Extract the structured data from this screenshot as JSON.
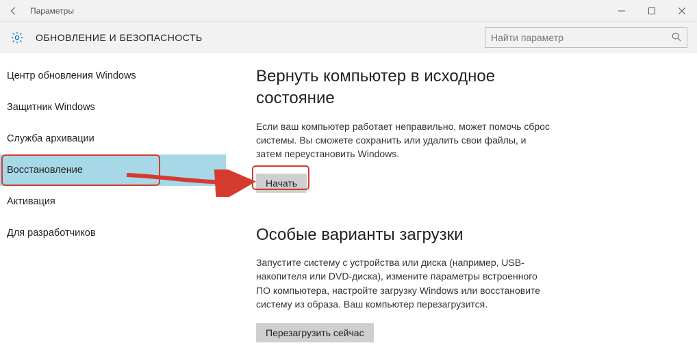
{
  "window": {
    "title": "Параметры"
  },
  "category": {
    "title": "ОБНОВЛЕНИЕ И БЕЗОПАСНОСТЬ"
  },
  "search": {
    "placeholder": "Найти параметр"
  },
  "sidebar": {
    "items": [
      {
        "label": "Центр обновления Windows"
      },
      {
        "label": "Защитник Windows"
      },
      {
        "label": "Служба архивации"
      },
      {
        "label": "Восстановление"
      },
      {
        "label": "Активация"
      },
      {
        "label": "Для разработчиков"
      }
    ]
  },
  "main": {
    "reset": {
      "heading": "Вернуть компьютер в исходное состояние",
      "desc": "Если ваш компьютер работает неправильно, может помочь сброс системы. Вы сможете сохранить или удалить свои файлы, и затем переустановить Windows.",
      "button": "Начать"
    },
    "adv": {
      "heading": "Особые варианты загрузки",
      "desc": "Запустите систему с устройства или диска (например, USB-накопителя или DVD-диска), измените параметры встроенного ПО компьютера, настройте загрузку Windows или восстановите систему из образа. Ваш компьютер перезагрузится.",
      "button": "Перезагрузить сейчас"
    }
  }
}
